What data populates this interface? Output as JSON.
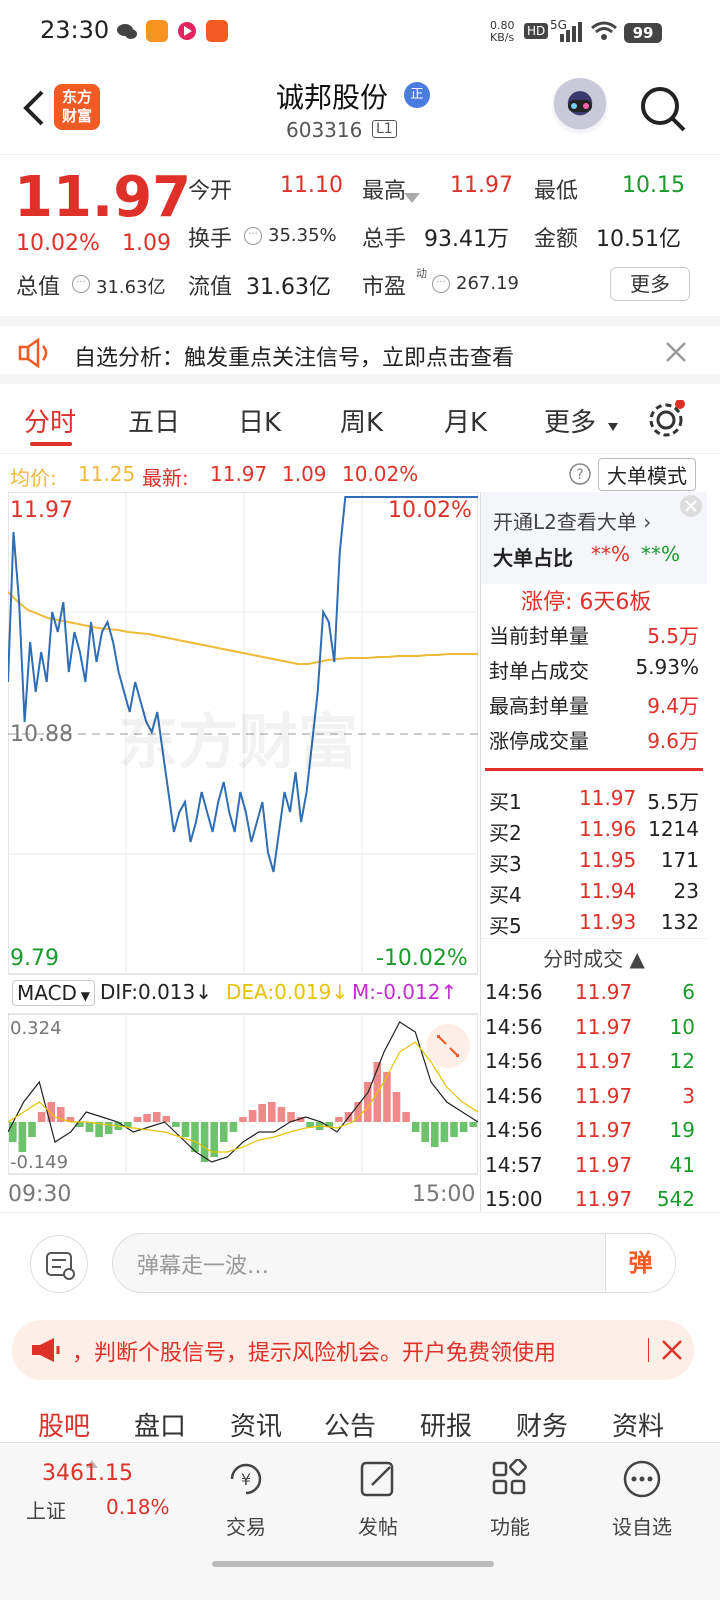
{
  "status_bar": {
    "time": "23:30",
    "net_speed": "0.80\nKB/s",
    "hd": "HD",
    "signal": "5G",
    "battery": "99"
  },
  "header": {
    "brand_logo": "东方\n财富",
    "stock_name": "诚邦股份",
    "badge": "正",
    "code": "603316",
    "level": "L1"
  },
  "quote": {
    "price": "11.97",
    "change_pct": "10.02%",
    "change_amt": "1.09",
    "open_label": "今开",
    "open": "11.10",
    "high_label": "最高",
    "high": "11.97",
    "low_label": "最低",
    "low": "10.15",
    "turnover_label": "换手",
    "turnover": "35.35%",
    "volume_label": "总手",
    "volume": "93.41万",
    "amount_label": "金额",
    "amount": "10.51亿",
    "mktcap_label": "总值",
    "mktcap": "31.63亿",
    "float_label": "流值",
    "float": "31.63亿",
    "pe_label": "市盈",
    "pe_sup": "动",
    "pe": "267.19",
    "more": "更多"
  },
  "alert": {
    "text": "自选分析：触发重点关注信号，立即点击查看"
  },
  "tabs": [
    "分时",
    "五日",
    "日K",
    "周K",
    "月K",
    "更多"
  ],
  "info_line": {
    "avg_label": "均价:",
    "avg": "11.25",
    "latest_label": "最新:",
    "latest": "11.97",
    "chg": "1.09",
    "pct": "10.02%",
    "mode": "大单模式"
  },
  "chart": {
    "top_price": "11.97",
    "top_pct": "10.02%",
    "mid_price": "10.88",
    "bottom_price": "9.79",
    "bottom_pct": "-10.02%",
    "watermark": "东方财富",
    "macd_label": "MACD",
    "dif": "DIF:0.013",
    "dea": "DEA:0.019",
    "m": "M:-0.012",
    "macd_top": "0.324",
    "macd_bottom": "-0.149",
    "time_start": "09:30",
    "time_end": "15:00"
  },
  "right_panel": {
    "l2_link": "开通L2查看大单",
    "big_ratio_label": "大单占比",
    "big_ratio_1": "**%",
    "big_ratio_2": "**%",
    "limit_label": "涨停: 6天6板",
    "stats": [
      {
        "label": "当前封单量",
        "value": "5.5万"
      },
      {
        "label": "封单占成交",
        "value": "5.93%"
      },
      {
        "label": "最高封单量",
        "value": "9.4万"
      },
      {
        "label": "涨停成交量",
        "value": "9.6万"
      }
    ],
    "bids": [
      {
        "label": "买1",
        "price": "11.97",
        "vol": "5.5万"
      },
      {
        "label": "买2",
        "price": "11.96",
        "vol": "1214"
      },
      {
        "label": "买3",
        "price": "11.95",
        "vol": "171"
      },
      {
        "label": "买4",
        "price": "11.94",
        "vol": "23"
      },
      {
        "label": "买5",
        "price": "11.93",
        "vol": "132"
      }
    ],
    "ticks_title": "分时成交",
    "ticks": [
      {
        "time": "14:56",
        "price": "11.97",
        "vol": "6"
      },
      {
        "time": "14:56",
        "price": "11.97",
        "vol": "10"
      },
      {
        "time": "14:56",
        "price": "11.97",
        "vol": "12"
      },
      {
        "time": "14:56",
        "price": "11.97",
        "vol": "3"
      },
      {
        "time": "14:56",
        "price": "11.97",
        "vol": "19"
      },
      {
        "time": "14:57",
        "price": "11.97",
        "vol": "41"
      },
      {
        "time": "15:00",
        "price": "11.97",
        "vol": "542"
      }
    ]
  },
  "danmu": {
    "placeholder": "弹幕走一波…",
    "send": "弹"
  },
  "promo": {
    "text": "，判断个股信号，提示风险机会。开户免费领使用"
  },
  "sub_tabs": [
    "股吧",
    "盘口",
    "资讯",
    "公告",
    "研报",
    "财务",
    "资料"
  ],
  "bottom_bar": {
    "index_value": "3461.15",
    "index_name": "上证",
    "index_pct": "0.18%",
    "items": [
      "交易",
      "发帖",
      "功能",
      "设自选"
    ]
  },
  "colors": {
    "up": "#e0302a",
    "down": "#1a9a2a",
    "avg_line": "#f0b93a",
    "price_line": "#2f6db5",
    "brand": "#f15a22"
  }
}
